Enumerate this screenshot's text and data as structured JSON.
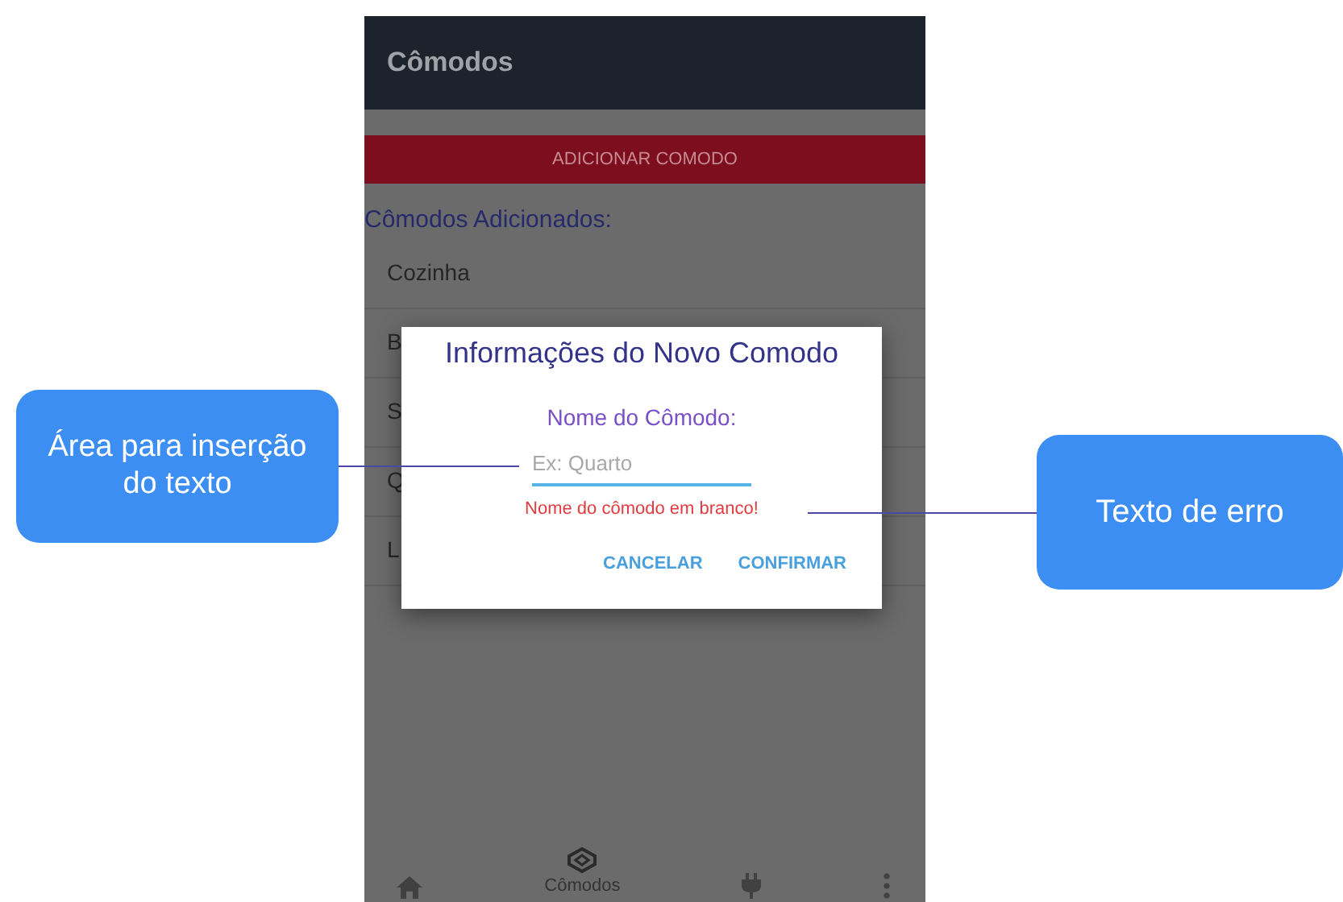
{
  "app_bar": {
    "title": "Cômodos"
  },
  "add_button": {
    "label": "ADICIONAR COMODO"
  },
  "list_heading": "Cômodos Adicionados:",
  "rooms": [
    {
      "name": "Cozinha"
    },
    {
      "name": "B"
    },
    {
      "name": "S"
    },
    {
      "name": "Q"
    },
    {
      "name": "L"
    }
  ],
  "dialog": {
    "title": "Informações do Novo Comodo",
    "field_label": "Nome do Cômodo:",
    "placeholder": "Ex: Quarto",
    "error": "Nome do cômodo em branco!",
    "buttons": [
      "CANCELAR",
      "CONFIRMAR"
    ]
  },
  "bottom_nav": [
    {
      "kind": "home",
      "selected": false
    },
    {
      "kind": "rooms",
      "label": "Cômodos",
      "selected": true
    },
    {
      "kind": "plug",
      "selected": false
    },
    {
      "kind": "more",
      "selected": false
    }
  ],
  "callouts": [
    {
      "kind": "left",
      "text": "Área para inserção do texto"
    },
    {
      "kind": "right",
      "text": "Texto de erro"
    }
  ]
}
